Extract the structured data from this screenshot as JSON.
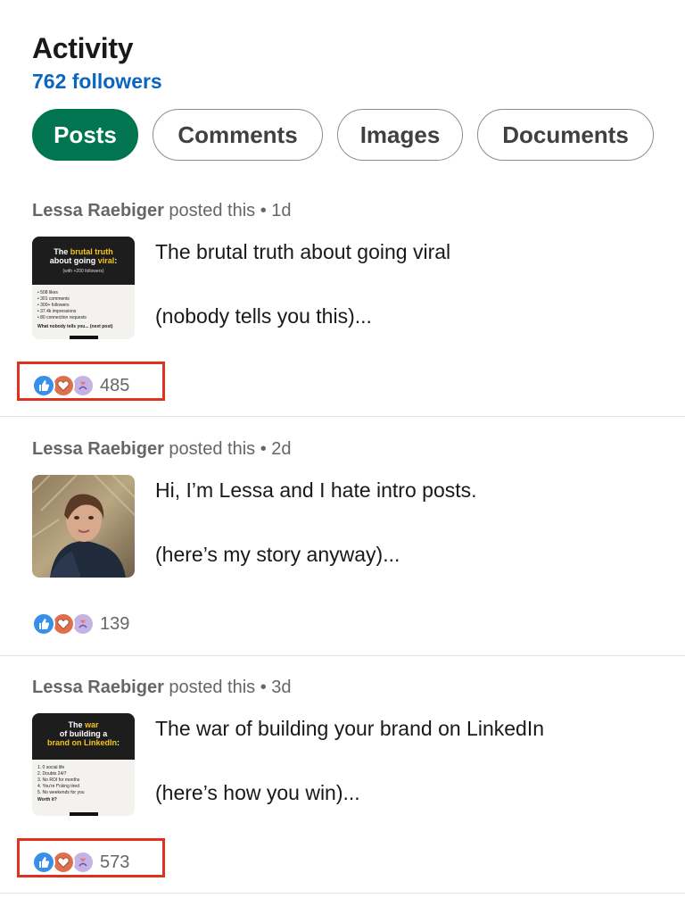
{
  "header": {
    "title": "Activity",
    "followers": "762 followers"
  },
  "tabs": [
    {
      "label": "Posts",
      "active": true
    },
    {
      "label": "Comments",
      "active": false
    },
    {
      "label": "Images",
      "active": false
    },
    {
      "label": "Documents",
      "active": false
    }
  ],
  "posts": [
    {
      "author": "Lessa Raebiger",
      "action": "posted this",
      "age": "1d",
      "line1": "The brutal truth about going viral",
      "line2": "(nobody tells you this)...",
      "reactions": "485",
      "highlighted": true,
      "thumb": {
        "title_a": "The ",
        "title_b": "brutal truth",
        "title_c": "about going ",
        "title_d": "viral",
        "title_e": ":",
        "subtitle": "(with +200 followers)",
        "items": [
          "• 508 likes",
          "• 301 comments",
          "• 300+ followers",
          "• 37.4k impressions",
          "• 80 connection requests"
        ],
        "footer": "What nobody tells you... (next post)"
      }
    },
    {
      "author": "Lessa Raebiger",
      "action": "posted this",
      "age": "2d",
      "line1": "Hi, I’m Lessa and I hate intro posts.",
      "line2": "(here’s my story anyway)...",
      "reactions": "139",
      "highlighted": false
    },
    {
      "author": "Lessa Raebiger",
      "action": "posted this",
      "age": "3d",
      "line1": "The war of building your brand on LinkedIn",
      "line2": "(here’s how you win)...",
      "reactions": "573",
      "highlighted": true,
      "thumb": {
        "title_a": "The ",
        "title_b": "war",
        "title_c": "of building a",
        "title_d": "brand on LinkedIn",
        "title_e": ":",
        "items": [
          "1. 0 social life",
          "2. Doubts 24/7",
          "3. No ROI for months",
          "4. You’re f*cking tired",
          "5. No weekends for you"
        ],
        "footer": "Worth it?"
      }
    }
  ],
  "separator": "•",
  "colors": {
    "accent": "#01754f",
    "link": "#0a66c2",
    "highlight": "#e0301e",
    "like": "#378fe9",
    "love": "#df704d",
    "support": "#c6b3e6"
  }
}
